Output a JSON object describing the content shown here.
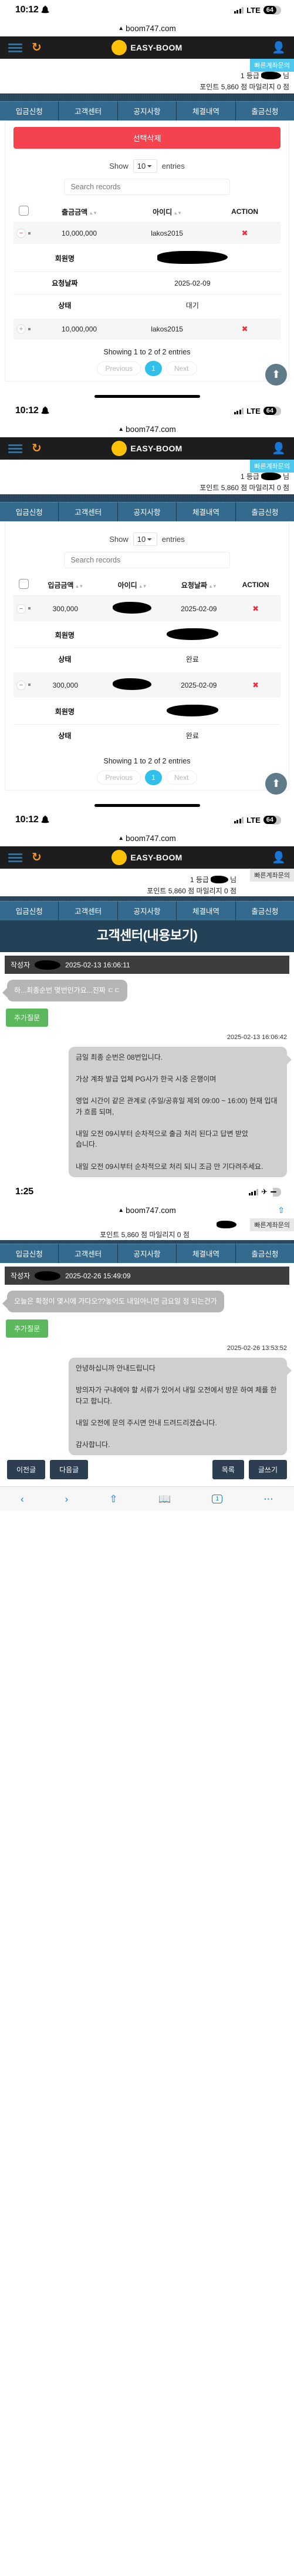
{
  "status_bars": [
    {
      "time": "10:12",
      "network": "LTE",
      "battery": "64"
    },
    {
      "time": "10:12",
      "network": "LTE",
      "battery": "64"
    },
    {
      "time": "10:12",
      "network": "LTE",
      "battery": "64"
    },
    {
      "time": "1:25",
      "network": "",
      "battery": ""
    }
  ],
  "browser": {
    "url": "boom747.com",
    "lock_icon": "▲",
    "share_icon": "⇧"
  },
  "appbar": {
    "brand": "EASY-BOOM",
    "menu_icon": "hamburger-icon",
    "refresh_icon": "↻",
    "user_icon": "P"
  },
  "account": {
    "quick_button": "빠른계좌문의",
    "grade_prefix": "1 등급",
    "grade_suffix": "님",
    "points_line": "포인트 5,860 점  마일리지 0 점"
  },
  "nav": {
    "tabs": [
      "입금신청",
      "고객센터",
      "공지사항",
      "체결내역",
      "출금신청"
    ]
  },
  "panel_withdraw": {
    "delete_button": "선택삭제",
    "show_label": "Show",
    "show_value": "10",
    "entries_label": "entries",
    "search_placeholder": "Search records",
    "columns": [
      "출금금액",
      "아이디",
      "ACTION"
    ],
    "rows": [
      {
        "amount": "10,000,000",
        "id": "lakos2015",
        "action": "✖",
        "expanded": true,
        "expander": "−",
        "details": [
          {
            "key": "회원명",
            "value": ""
          },
          {
            "key": "요청날짜",
            "value": "2025-02-09"
          },
          {
            "key": "상태",
            "value": "대기"
          }
        ]
      },
      {
        "amount": "10,000,000",
        "id": "lakos2015",
        "action": "✖",
        "expanded": false,
        "expander": "+",
        "details": []
      }
    ],
    "info": "Showing 1 to 2 of 2 entries",
    "pager": {
      "previous": "Previous",
      "current": "1",
      "next": "Next"
    },
    "scroll_top_icon": "⬆"
  },
  "panel_deposit": {
    "show_label": "Show",
    "show_value": "10",
    "entries_label": "entries",
    "search_placeholder": "Search records",
    "columns": [
      "입금금액",
      "아이디",
      "요청날짜",
      "ACTION"
    ],
    "rows": [
      {
        "amount": "300,000",
        "id": "",
        "date": "2025-02-09",
        "action": "✖",
        "expanded": true,
        "expander": "−",
        "details": [
          {
            "key": "회원명",
            "value": ""
          },
          {
            "key": "상태",
            "value": "완료"
          }
        ]
      },
      {
        "amount": "300,000",
        "id": "",
        "date": "2025-02-09",
        "action": "✖",
        "expanded": true,
        "expander": "−",
        "details": [
          {
            "key": "회원명",
            "value": ""
          },
          {
            "key": "상태",
            "value": "완료"
          }
        ]
      }
    ],
    "info": "Showing 1 to 2 of 2 entries",
    "pager": {
      "previous": "Previous",
      "current": "1",
      "next": "Next"
    },
    "scroll_top_icon": "⬆"
  },
  "panel_support_1": {
    "title": "고객센터(내용보기)",
    "author_label": "작성자",
    "author_timestamp": "2025-02-13 16:06:11",
    "message_in": "하...최종순번 몇번인가요...진짜 ㄷㄷ",
    "add_button": "추가질문",
    "reply_timestamp": "2025-02-13 16:06:42",
    "message_out": "금일 최종 순번은 08번입니다.\n\n가상 계좌 발급 업체 PG사가 한국 시중 은행이며\n\n영업 시간이 같은 관계로 (주일/공휴일 제외 09:00 ~ 16:00) 현재 입대가 흐름 되며,\n\n내일 오전 09시부터 순차적으로 출금 처리 된다고 답변 받았\n습니다.\n\n내일 오전 09시부터 순차적으로 처리 되니 조금 만 기다려주세요."
  },
  "panel_support_2": {
    "author_label": "작성자",
    "author_timestamp": "2025-02-26 15:49:09",
    "message_in": "오늘은 확정이 몇시에 가다오??놓어도 내일아니면 금요일 정 되는건가",
    "add_button": "추가질문",
    "reply_timestamp": "2025-02-26 13:53:52",
    "message_out": "안녕하십니까 안내드립니다\n\n방의자가 구내에야 할 서류가 있어서 내일 오전에서 방문 하여 체를 한다고 합니다.\n\n내일 오전에 문의 주시면 안내 드려드리겠습니다.\n\n감사합니다.",
    "buttons": {
      "previous": "이전글",
      "next": "다음글",
      "list": "목록",
      "write": "글쓰기"
    }
  },
  "safari_toolbar": {
    "back": "‹",
    "forward": "›",
    "share": "⇧",
    "tabs": "1",
    "more": "⋯"
  }
}
